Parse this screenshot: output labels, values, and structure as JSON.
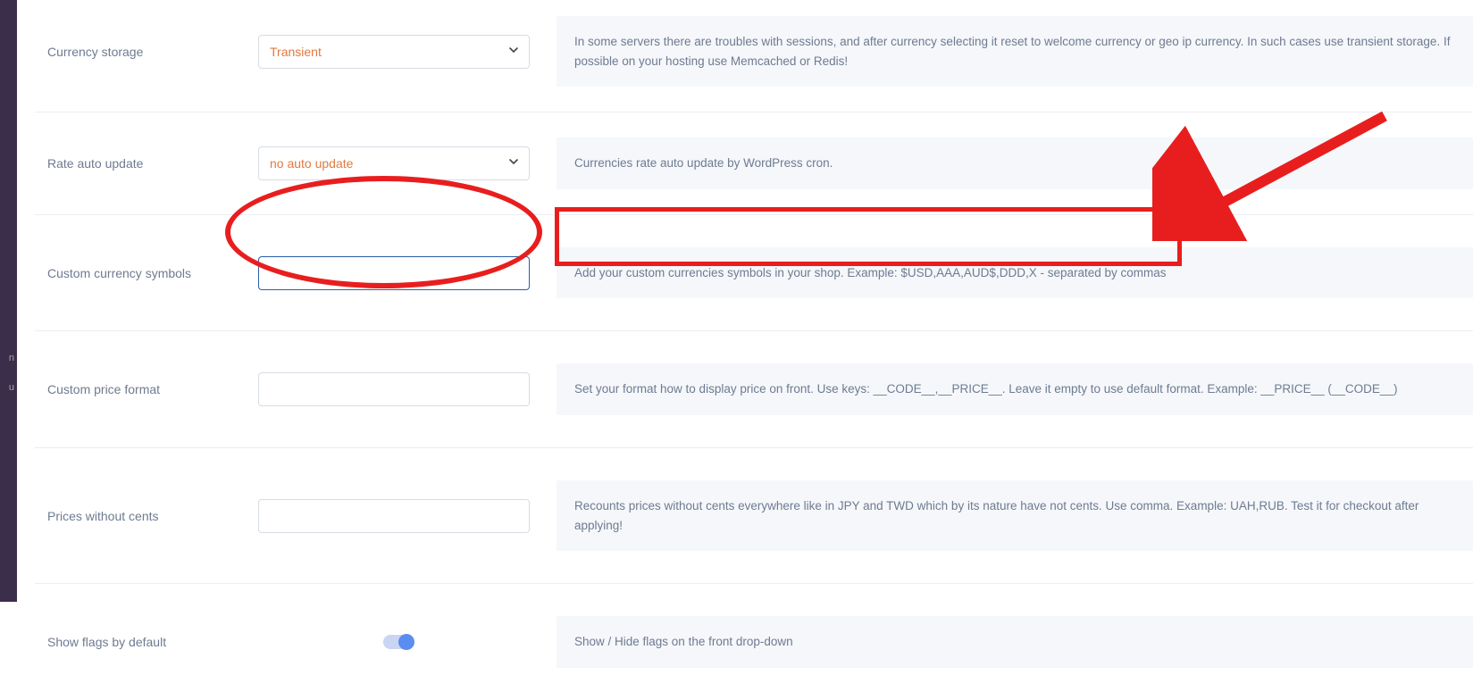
{
  "sidebar": {
    "frag1": "n",
    "frag2": "u"
  },
  "rows": {
    "currency_storage": {
      "label": "Currency storage",
      "value": "Transient",
      "help": "In some servers there are troubles with sessions, and after currency selecting it reset to welcome currency or geo ip currency. In such cases use transient storage. If possible on your hosting use Memcached or Redis!"
    },
    "rate_auto_update": {
      "label": "Rate auto update",
      "value": "no auto update",
      "help": "Currencies rate auto update by WordPress cron."
    },
    "custom_currency_symbols": {
      "label": "Custom currency symbols",
      "value": "",
      "help": "Add your custom currencies symbols in your shop. Example: $USD,AAA,AUD$,DDD,X - separated by commas"
    },
    "custom_price_format": {
      "label": "Custom price format",
      "value": "",
      "help": "Set your format how to display price on front. Use keys: __CODE__,__PRICE__. Leave it empty to use default format. Example: __PRICE__ (__CODE__)"
    },
    "prices_without_cents": {
      "label": "Prices without cents",
      "value": "",
      "help": "Recounts prices without cents everywhere like in JPY and TWD which by its nature have not cents. Use comma. Example: UAH,RUB. Test it for checkout after applying!"
    },
    "show_flags": {
      "label": "Show flags by default",
      "help": "Show / Hide flags on the front drop-down"
    }
  }
}
